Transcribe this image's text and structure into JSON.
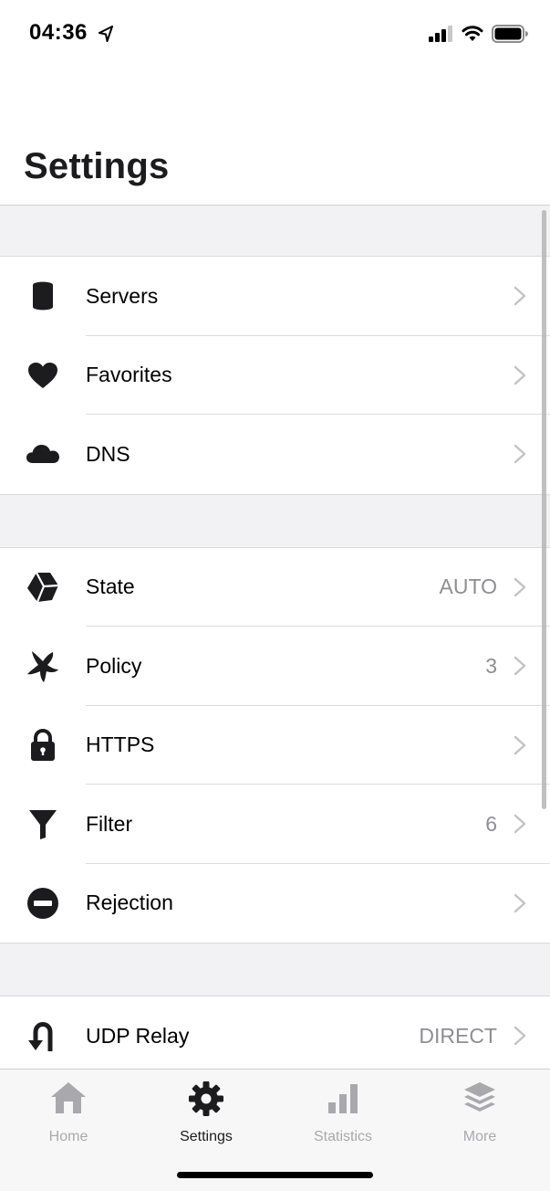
{
  "status_bar": {
    "time": "04:36",
    "icons": [
      "location-arrow-icon",
      "cellular-signal-icon",
      "wifi-icon",
      "battery-icon"
    ]
  },
  "page": {
    "title": "Settings"
  },
  "groups": [
    {
      "rows": [
        {
          "label": "Servers",
          "value": "",
          "icon": "database-icon"
        },
        {
          "label": "Favorites",
          "value": "",
          "icon": "heart-icon"
        },
        {
          "label": "DNS",
          "value": "",
          "icon": "cloud-icon"
        }
      ]
    },
    {
      "rows": [
        {
          "label": "State",
          "value": "AUTO",
          "icon": "cube-icon"
        },
        {
          "label": "Policy",
          "value": "3",
          "icon": "policy-icon"
        },
        {
          "label": "HTTPS",
          "value": "",
          "icon": "lock-icon"
        },
        {
          "label": "Filter",
          "value": "6",
          "icon": "funnel-icon"
        },
        {
          "label": "Rejection",
          "value": "",
          "icon": "no-entry-icon"
        }
      ]
    },
    {
      "rows": [
        {
          "label": "UDP Relay",
          "value": "DIRECT",
          "icon": "u-turn-icon"
        }
      ]
    }
  ],
  "tab_bar": {
    "tabs": [
      {
        "label": "Home",
        "icon": "house-icon",
        "active": false
      },
      {
        "label": "Settings",
        "icon": "gear-icon",
        "active": true
      },
      {
        "label": "Statistics",
        "icon": "bar-chart-icon",
        "active": false
      },
      {
        "label": "More",
        "icon": "layers-icon",
        "active": false
      }
    ]
  },
  "colors": {
    "text_primary": "#1c1c1e",
    "text_secondary": "#8e8e93",
    "tab_inactive": "#a9a9ad",
    "group_background": "#f2f2f4"
  }
}
